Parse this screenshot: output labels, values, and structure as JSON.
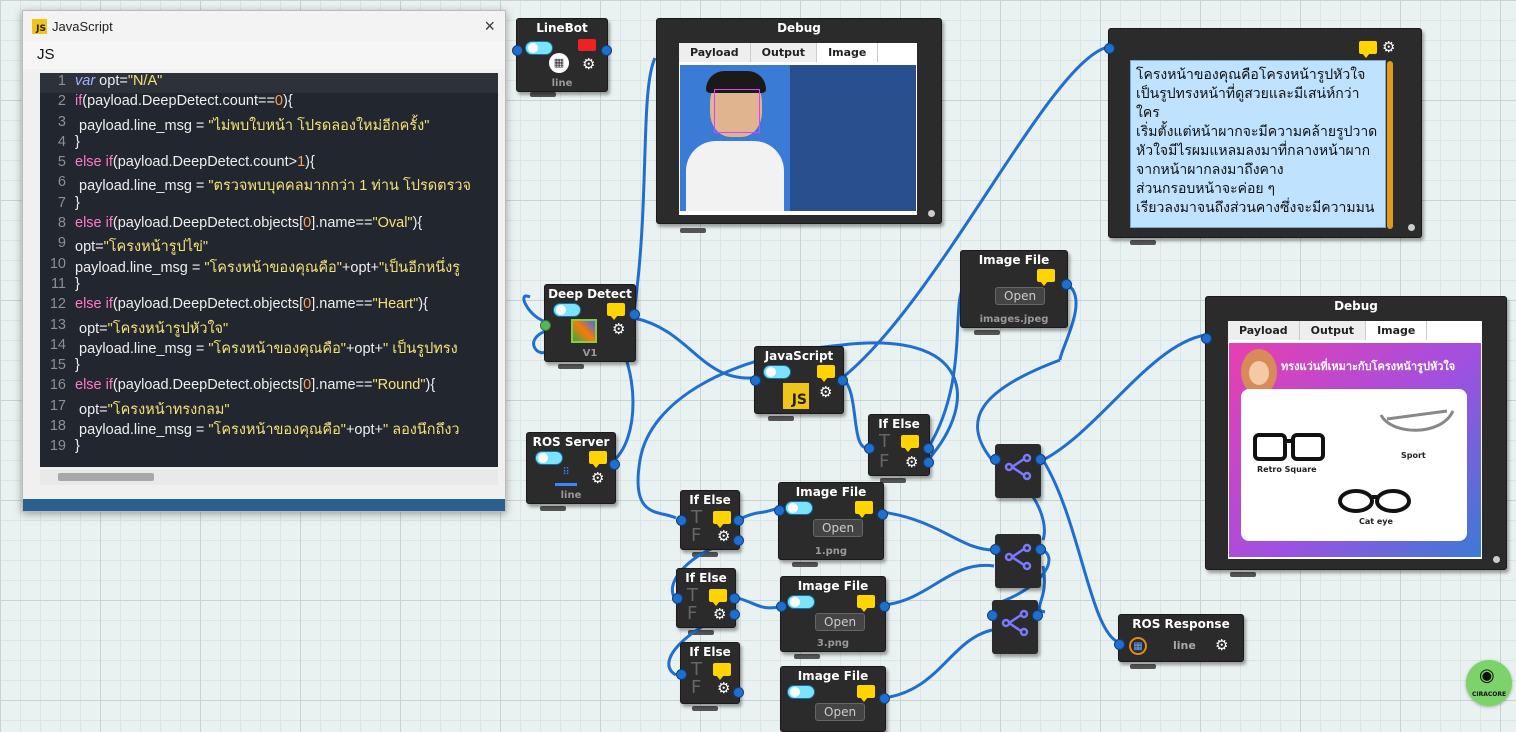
{
  "js_window": {
    "title": "JavaScript",
    "badge": "JS",
    "close": "×",
    "tab": "JS",
    "side_handle": ">",
    "code_lines": [
      {
        "n": "1",
        "html": "<span class='it'>var</span> opt=<span class='str'>\"N/A\"</span>"
      },
      {
        "n": "2",
        "html": "<span class='kw'>if</span>(payload.DeepDetect.count==<span class='num'>0</span>){"
      },
      {
        "n": "3",
        "html": " payload.line_msg = <span class='str'>\"ไม่พบใบหน้า โปรดลองใหม่อีกครั้ง\"</span>"
      },
      {
        "n": "4",
        "html": "}"
      },
      {
        "n": "5",
        "html": "<span class='kw'>else if</span>(payload.DeepDetect.count><span class='num'>1</span>){"
      },
      {
        "n": "6",
        "html": " payload.line_msg = <span class='str'>\"ตรวจพบบุคคลมากกว่า 1 ท่าน โปรดตรวจ</span>"
      },
      {
        "n": "7",
        "html": "}"
      },
      {
        "n": "8",
        "html": "<span class='kw'>else if</span>(payload.DeepDetect.objects[<span class='num'>0</span>].name==<span class='str'>\"Oval\"</span>){"
      },
      {
        "n": "9",
        "html": "opt=<span class='str'>\"โครงหน้ารูปไข่\"</span>"
      },
      {
        "n": "10",
        "html": "payload.line_msg = <span class='str'>\"โครงหน้าของคุณคือ\"</span>+opt+<span class='str'>\"เป็นอีกหนึ่งรู</span>"
      },
      {
        "n": "11",
        "html": "}"
      },
      {
        "n": "12",
        "html": "<span class='kw'>else if</span>(payload.DeepDetect.objects[<span class='num'>0</span>].name==<span class='str'>\"Heart\"</span>){"
      },
      {
        "n": "13",
        "html": " opt=<span class='str'>\"โครงหน้ารูปหัวใจ\"</span>"
      },
      {
        "n": "14",
        "html": " payload.line_msg = <span class='str'>\"โครงหน้าของคุณคือ\"</span>+opt+<span class='str'>\" เป็นรูปทรง</span>"
      },
      {
        "n": "15",
        "html": "}"
      },
      {
        "n": "16",
        "html": "<span class='kw'>else if</span>(payload.DeepDetect.objects[<span class='num'>0</span>].name==<span class='str'>\"Round\"</span>){"
      },
      {
        "n": "17",
        "html": " opt=<span class='str'>\"โครงหน้าทรงกลม\"</span>"
      },
      {
        "n": "18",
        "html": " payload.line_msg = <span class='str'>\"โครงหน้าของคุณคือ\"</span>+opt+<span class='str'>\" ลองนึกถึงว</span>"
      },
      {
        "n": "19",
        "html": "}"
      }
    ]
  },
  "nodes": {
    "linebot": {
      "title": "LineBot",
      "sub": "line"
    },
    "debug1": {
      "title": "Debug",
      "tabs": [
        "Payload",
        "Output",
        "Image"
      ]
    },
    "debug2": {
      "title": "Debug",
      "tabs": [
        "Payload",
        "Output",
        "Image"
      ],
      "card_title": "ทรงแว่นที่เหมาะกับโครงหน้ารูปหัวใจ",
      "glasses": [
        "Retro Square",
        "Sport",
        "Cat eye"
      ]
    },
    "deep_detect": {
      "title": "Deep Detect",
      "sub": "V1"
    },
    "ros_server": {
      "title": "ROS Server",
      "sub": "line"
    },
    "javascript": {
      "title": "JavaScript",
      "badge": "JS"
    },
    "ifelse_main": {
      "title": "If Else",
      "t": "T",
      "f": "F"
    },
    "image_file_top": {
      "title": "Image File",
      "button": "Open",
      "sub": "images.jpeg"
    },
    "ifelse_1": {
      "title": "If Else",
      "t": "T",
      "f": "F"
    },
    "ifelse_2": {
      "title": "If Else",
      "t": "T",
      "f": "F"
    },
    "ifelse_3": {
      "title": "If Else",
      "t": "T",
      "f": "F"
    },
    "image_file_1": {
      "title": "Image File",
      "button": "Open",
      "sub": "1.png"
    },
    "image_file_3": {
      "title": "Image File",
      "button": "Open",
      "sub": "3.png"
    },
    "image_file_4": {
      "title": "Image File",
      "button": "Open"
    },
    "ros_response": {
      "title": "ROS Response",
      "sub": "line"
    }
  },
  "text_panel": {
    "text": "โครงหน้าของคุณคือโครงหน้ารูปหัวใจ เป็นรูปทรงหน้าที่ดูสวยและมีเสน่ห์กว่าใคร\nเริ่มตั้งแต่หน้าผากจะมีความคล้ายรูปวาดหัวใจมีไรผมแหลมลงมาที่กลางหน้าผาก จากหน้าผากลงมาถึงคาง\nส่วนกรอบหน้าจะค่อย ๆ\nเรียวลงมาจนถึงส่วนคางซึ่งจะมีความมน"
  },
  "logo": {
    "text": "CIRACORE"
  },
  "colors": {
    "wire": "#1f6fcf",
    "node": "#2b2b2b",
    "accent_yellow": "#ffd400",
    "toggle": "#7ce3ff"
  }
}
